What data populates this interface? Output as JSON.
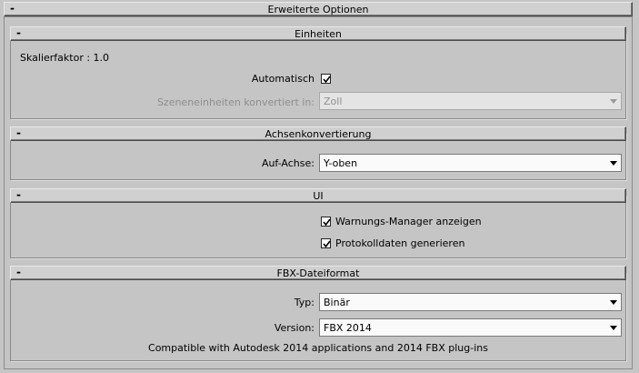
{
  "advanced": {
    "title": "Erweiterte Optionen",
    "collapse_symbol": "-"
  },
  "units": {
    "title": "Einheiten",
    "collapse_symbol": "-",
    "scale_factor_label": "Skalierfaktor : 1.0",
    "automatic_label": "Automatisch",
    "automatic_checked": true,
    "convert_label": "Szeneneinheiten konvertiert in:",
    "convert_value": "Zoll"
  },
  "axis": {
    "title": "Achsenkonvertierung",
    "collapse_symbol": "-",
    "up_axis_label": "Auf-Achse:",
    "up_axis_value": "Y-oben"
  },
  "ui": {
    "title": "UI",
    "collapse_symbol": "-",
    "warnings_label": "Warnungs-Manager anzeigen",
    "warnings_checked": true,
    "log_label": "Protokolldaten generieren",
    "log_checked": true
  },
  "fbx": {
    "title": "FBX-Dateiformat",
    "collapse_symbol": "-",
    "type_label": "Typ:",
    "type_value": "Binär",
    "version_label": "Version:",
    "version_value": "FBX 2014",
    "compat_text": "Compatible with Autodesk 2014 applications and 2014 FBX plug-ins"
  }
}
